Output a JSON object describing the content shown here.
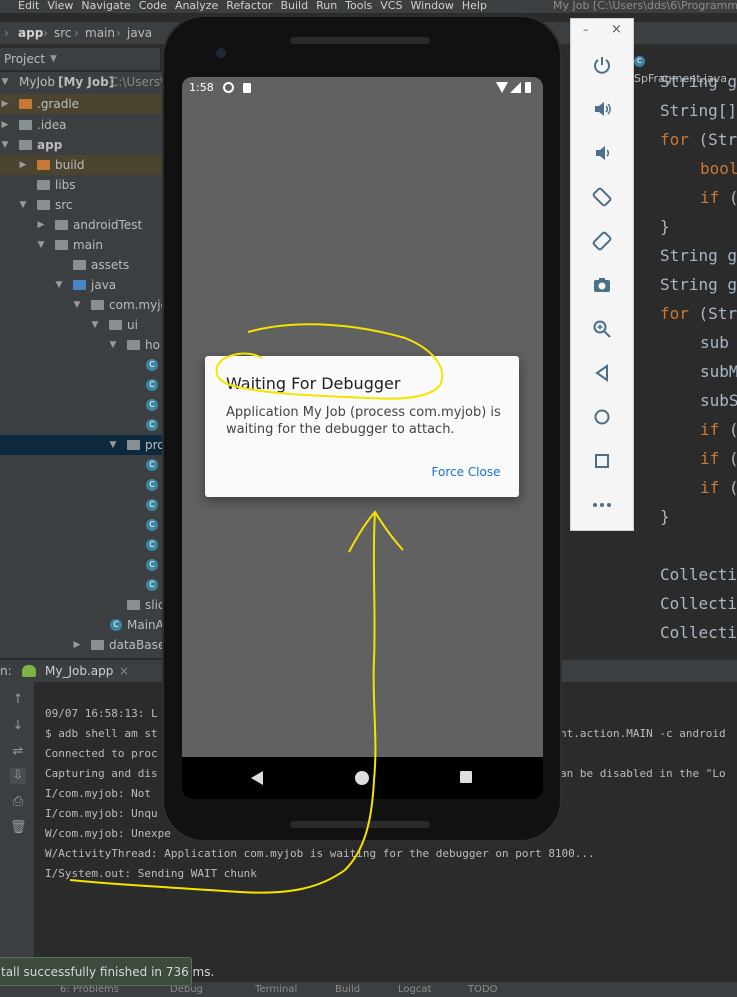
{
  "menu": {
    "items": [
      "Edit",
      "View",
      "Navigate",
      "Code",
      "Analyze",
      "Refactor",
      "Build",
      "Run",
      "Tools",
      "VCS",
      "Window",
      "Help"
    ],
    "window_title": "My Job [C:\\Users\\dds\\6\\Programm"
  },
  "breadcrumb": [
    "app",
    "src",
    "main",
    "java"
  ],
  "project_panel": {
    "header": "Project",
    "tree": [
      {
        "label": "MyJob",
        "bold_suffix": "[My Job]",
        "path": "C:\\Users\\d"
      },
      {
        "label": ".gradle"
      },
      {
        "label": ".idea"
      },
      {
        "label": "app"
      },
      {
        "label": "build"
      },
      {
        "label": "libs"
      },
      {
        "label": "src"
      },
      {
        "label": "androidTest"
      },
      {
        "label": "main"
      },
      {
        "label": "assets"
      },
      {
        "label": "java"
      },
      {
        "label": "com.myjob"
      },
      {
        "label": "ui"
      },
      {
        "label": "ho"
      },
      {
        "label": "pro"
      },
      {
        "label": "slic"
      },
      {
        "label": "MainA"
      },
      {
        "label": "dataBase"
      }
    ]
  },
  "editor": {
    "tab_label": "SpFragment.java",
    "lines": [
      {
        "kw": "",
        "text": "String g"
      },
      {
        "kw": "",
        "text": "String[]"
      },
      {
        "kw": "for",
        "text": " (Str"
      },
      {
        "kw": "bool",
        "text": ""
      },
      {
        "kw": "if",
        "text": " ("
      },
      {
        "kw": "",
        "text": "}"
      },
      {
        "kw": "",
        "text": "String g"
      },
      {
        "kw": "",
        "text": "String g"
      },
      {
        "kw": "for",
        "text": " (Str"
      },
      {
        "kw": "",
        "text": "sub"
      },
      {
        "kw": "",
        "text": "subM"
      },
      {
        "kw": "",
        "text": "subS"
      },
      {
        "kw": "if",
        "text": " ("
      },
      {
        "kw": "if",
        "text": " ("
      },
      {
        "kw": "if",
        "text": " ("
      },
      {
        "kw": "",
        "text": "}"
      },
      {
        "kw": "",
        "text": ""
      },
      {
        "kw": "",
        "text": "Collecti"
      },
      {
        "kw": "",
        "text": "Collecti"
      },
      {
        "kw": "",
        "text": "Collecti"
      }
    ]
  },
  "run_panel": {
    "prefix": "n:",
    "tab_label": "My_Job.app",
    "console": [
      "09/07 16:58:13: L",
      "$ adb shell am st",
      "Connected to proc",
      "Capturing and dis",
      "I/com.myjob: Not",
      "I/com.myjob: Unqu",
      "W/com.myjob: Unexpe",
      "W/ActivityThread: Application com.myjob is waiting for the debugger on port 8100...",
      "I/System.out: Sending WAIT chunk"
    ],
    "console_right": [
      "",
      "nt.action.MAIN -c android",
      "",
      "an be disabled in the \"Lo"
    ]
  },
  "status": {
    "toast": "tall successfully finished in 736 ms.",
    "bottom_tabs": [
      "6: Problems",
      "Debug",
      "Terminal",
      "Build",
      "Logcat",
      "TODO"
    ]
  },
  "phone": {
    "time": "1:58",
    "dialog": {
      "title": "Waiting For Debugger",
      "message": "Application My Job (process com.myjob) is waiting for the debugger to attach.",
      "button": "Force Close"
    }
  },
  "emulator_tools": [
    "power-icon",
    "volume-up-icon",
    "volume-down-icon",
    "rotate-left-icon",
    "rotate-right-icon",
    "camera-icon",
    "zoom-icon",
    "back-icon",
    "home-icon",
    "overview-icon",
    "more-icon"
  ],
  "colors": {
    "ide_bg": "#2b2b2b",
    "panel_bg": "#3c3f41",
    "keyword": "#cc7832",
    "annotation": "#f5e400",
    "dialog_accent": "#1a73c8"
  }
}
